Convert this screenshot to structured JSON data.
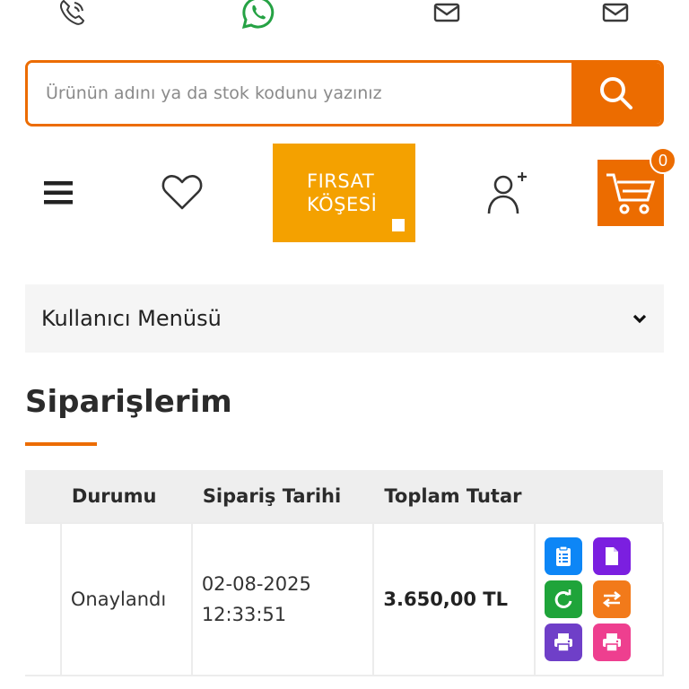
{
  "colors": {
    "accent": "#ec6c00",
    "promo": "#f4a100",
    "whatsapp": "#25a244",
    "action_blue": "#0d86f6",
    "action_purple": "#7b1fe0",
    "action_green": "#1fa43a",
    "action_orange": "#f27a1a",
    "action_violet": "#6f3fc8",
    "action_pink": "#ee3f8f"
  },
  "contact_icons": [
    "phone-icon",
    "whatsapp-icon",
    "mail-icon",
    "mail-icon"
  ],
  "search": {
    "placeholder": "Ürünün adını ya da stok kodunu yazınız",
    "icon": "search-icon"
  },
  "nav": {
    "menu_icon": "hamburger-icon",
    "favorites_icon": "heart-icon",
    "promo_line1": "FIRSAT",
    "promo_line2": "KÖŞESİ",
    "user_icon": "add-user-icon",
    "cart_icon": "cart-icon",
    "cart_count": "0"
  },
  "user_menu": {
    "label": "Kullanıcı Menüsü",
    "icon": "chevron-down-icon"
  },
  "page": {
    "title": "Siparişlerim"
  },
  "orders": {
    "columns": [
      "",
      "Durumu",
      "Sipariş Tarihi",
      "Toplam Tutar",
      ""
    ],
    "rows": [
      {
        "status": "Onaylandı",
        "date": "02-08-2025",
        "time": "12:33:51",
        "total": "3.650,00 TL",
        "actions": [
          "clipboard-list-icon",
          "document-icon",
          "refresh-icon",
          "exchange-icon",
          "print-icon",
          "print-icon"
        ]
      }
    ]
  }
}
